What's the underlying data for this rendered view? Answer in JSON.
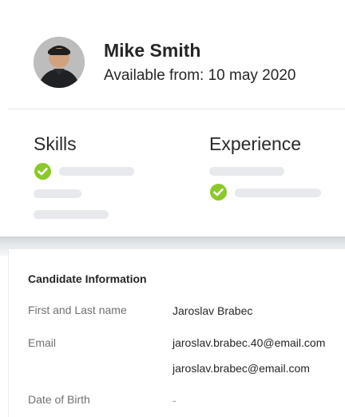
{
  "profile": {
    "name": "Mike Smith",
    "available": "Available from: 10 may 2020"
  },
  "sections": {
    "skills_title": "Skills",
    "experience_title": "Experience"
  },
  "candidate": {
    "title": "Candidate Information",
    "fields": [
      {
        "label": "First and Last name",
        "values": [
          "Jaroslav Brabec"
        ]
      },
      {
        "label": "Email",
        "values": [
          "jaroslav.brabec.40@email.com",
          "jaroslav.brabec@email.com"
        ]
      },
      {
        "label": "Date of Birth",
        "values": [
          "-"
        ]
      }
    ]
  },
  "colors": {
    "check_green": "#8bc928",
    "placeholder_bar": "#e7e9ec"
  },
  "icons": {
    "avatar": "person-photo",
    "check": "check-circle-icon"
  }
}
